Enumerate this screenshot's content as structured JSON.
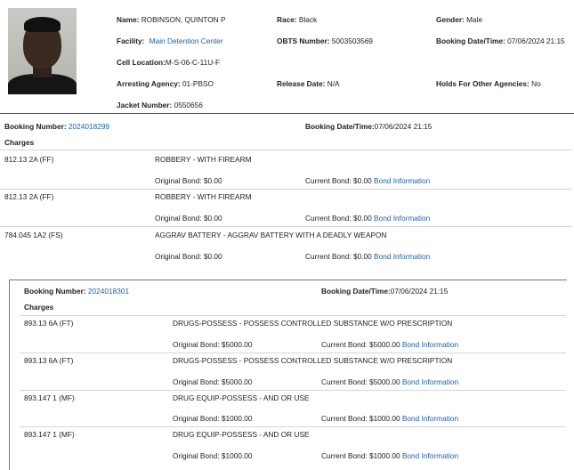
{
  "inmate": {
    "name_label": "Name:",
    "name": "ROBINSON, QUINTON P",
    "race_label": "Race:",
    "race": "Black",
    "gender_label": "Gender:",
    "gender": "Male",
    "facility_label": "Facility:",
    "facility": "Main Detention Center",
    "obts_label": "OBTS Number:",
    "obts": "5003503569",
    "booking_dt_label": "Booking Date/Time:",
    "booking_dt": "07/06/2024 21:15",
    "cell_label": "Cell Location:",
    "cell": "M-S-06-C-11U-F",
    "agency_label": "Arresting Agency:",
    "agency": "01-PBSO",
    "release_label": "Release Date:",
    "release": "N/A",
    "holds_label": "Holds For Other Agencies:",
    "holds": "No",
    "jacket_label": "Jacket Number:",
    "jacket": "0550656"
  },
  "bookings": [
    {
      "number_label": "Booking Number:",
      "number": "2024018299",
      "dt_label": "Booking Date/Time:",
      "dt": "07/06/2024 21:15",
      "charges_label": "Charges",
      "charges": [
        {
          "statute": "812.13 2A (FF)",
          "desc": "ROBBERY - WITH FIREARM",
          "orig_label": "Original Bond:",
          "orig": "$0.00",
          "curr_label": "Current Bond:",
          "curr": "$0.00",
          "info": "Bond Information"
        },
        {
          "statute": "812.13 2A (FF)",
          "desc": "ROBBERY - WITH FIREARM",
          "orig_label": "Original Bond:",
          "orig": "$0.00",
          "curr_label": "Current Bond:",
          "curr": "$0.00",
          "info": "Bond Information"
        },
        {
          "statute": "784.045 1A2 (FS)",
          "desc": "AGGRAV BATTERY - AGGRAV BATTERY WITH A DEADLY WEAPON",
          "orig_label": "Original Bond:",
          "orig": "$0.00",
          "curr_label": "Current Bond:",
          "curr": "$0.00",
          "info": "Bond Information"
        }
      ]
    },
    {
      "number_label": "Booking Number:",
      "number": "2024018301",
      "dt_label": "Booking Date/Time:",
      "dt": "07/06/2024 21:15",
      "charges_label": "Charges",
      "charges": [
        {
          "statute": "893.13 6A (FT)",
          "desc": "DRUGS-POSSESS - POSSESS CONTROLLED SUBSTANCE W/O PRESCRIPTION",
          "orig_label": "Original Bond:",
          "orig": "$5000.00",
          "curr_label": "Current Bond:",
          "curr": "$5000.00",
          "info": "Bond Information"
        },
        {
          "statute": "893.13 6A (FT)",
          "desc": "DRUGS-POSSESS - POSSESS CONTROLLED SUBSTANCE W/O PRESCRIPTION",
          "orig_label": "Original Bond:",
          "orig": "$5000.00",
          "curr_label": "Current Bond:",
          "curr": "$5000.00",
          "info": "Bond Information"
        },
        {
          "statute": "893.147 1 (MF)",
          "desc": "DRUG EQUIP-POSSESS - AND OR USE",
          "orig_label": "Original Bond:",
          "orig": "$1000.00",
          "curr_label": "Current Bond:",
          "curr": "$1000.00",
          "info": "Bond Information"
        },
        {
          "statute": "893.147 1 (MF)",
          "desc": "DRUG EQUIP-POSSESS - AND OR USE",
          "orig_label": "Original Bond:",
          "orig": "$1000.00",
          "curr_label": "Current Bond:",
          "curr": "$1000.00",
          "info": "Bond Information"
        }
      ]
    }
  ]
}
